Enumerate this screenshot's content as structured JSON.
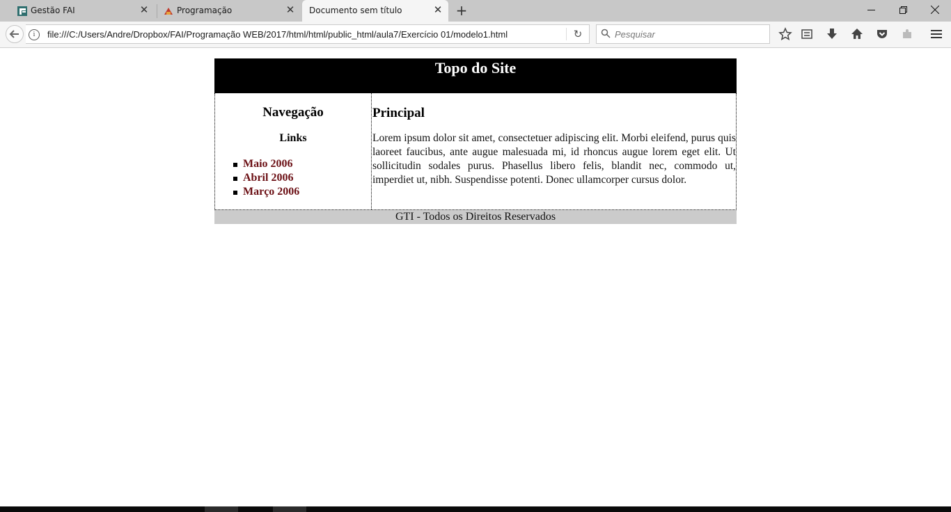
{
  "browser": {
    "tabs": [
      {
        "label": "Gestão FAI",
        "active": false,
        "icon": "gestao-fai-favicon"
      },
      {
        "label": "Programação",
        "active": false,
        "icon": "programacao-favicon"
      },
      {
        "label": "Documento sem título",
        "active": true,
        "icon": ""
      }
    ],
    "new_tab_icon": "plus-icon",
    "url": "file:///C:/Users/Andre/Dropbox/FAI/Programação WEB/2017/html/html/public_html/aula7/Exercício 01/modelo1.html",
    "search_placeholder": "Pesquisar",
    "toolbar_icons": [
      "star-icon",
      "reading-list-icon",
      "download-icon",
      "home-icon",
      "pocket-icon",
      "extension-icon",
      "menu-icon"
    ]
  },
  "site": {
    "top_title": "Topo do Site",
    "nav": {
      "heading": "Navegação",
      "subheading": "Links",
      "links": [
        "Maio 2006",
        "Abril 2006",
        "Março 2006"
      ]
    },
    "main": {
      "heading": "Principal",
      "text": "Lorem ipsum dolor sit amet, consectetuer adipiscing elit. Morbi eleifend, purus quis laoreet faucibus, ante augue malesuada mi, id rhoncus augue lorem eget elit. Ut sollicitudin sodales purus. Phasellus libero felis, blandit nec, commodo ut, imperdiet ut, nibh. Suspendisse potenti. Donec ullamcorper cursus dolor."
    },
    "footer": "GTI - Todos os Direitos Reservados"
  },
  "colors": {
    "header_bg": "#000000",
    "footer_bg": "#cbcbcb",
    "link": "#6b0f14"
  }
}
